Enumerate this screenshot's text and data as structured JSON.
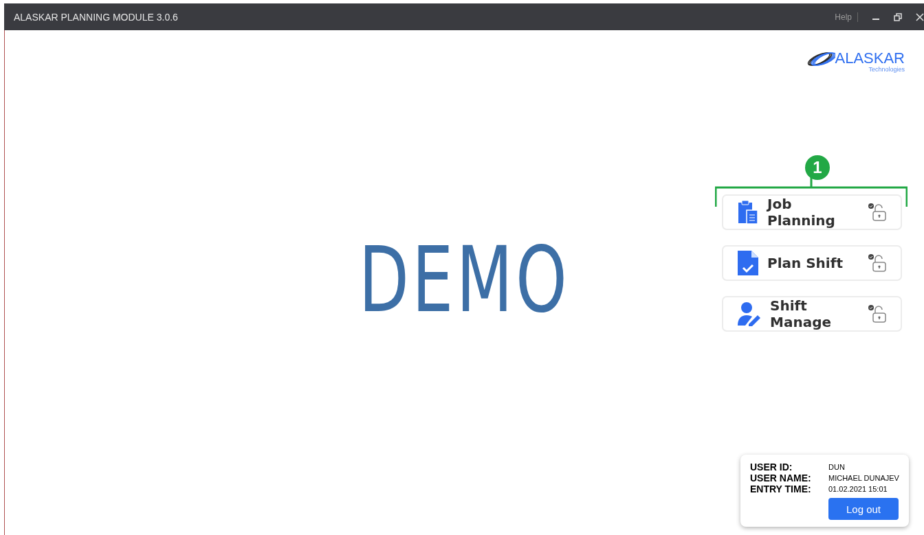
{
  "window": {
    "title": "ALASKAR PLANNING MODULE 3.0.6",
    "help": "Help"
  },
  "logo": {
    "name": "ALASKAR",
    "tagline": "Technologies"
  },
  "watermark_text": "DEMO",
  "callout": {
    "number": "1"
  },
  "modules": [
    {
      "label": "Job Planning",
      "kind": "clipboard"
    },
    {
      "label": "Plan Shift",
      "kind": "document"
    },
    {
      "label": "Shift Manage",
      "kind": "user"
    }
  ],
  "user_info": {
    "fields": [
      {
        "label": "USER ID:",
        "value": "DUN"
      },
      {
        "label": "USER NAME:",
        "value": "MICHAEL DUNAJEV"
      },
      {
        "label": "ENTRY TIME:",
        "value": "01.02.2021 15:01"
      }
    ],
    "logout": "Log out"
  }
}
